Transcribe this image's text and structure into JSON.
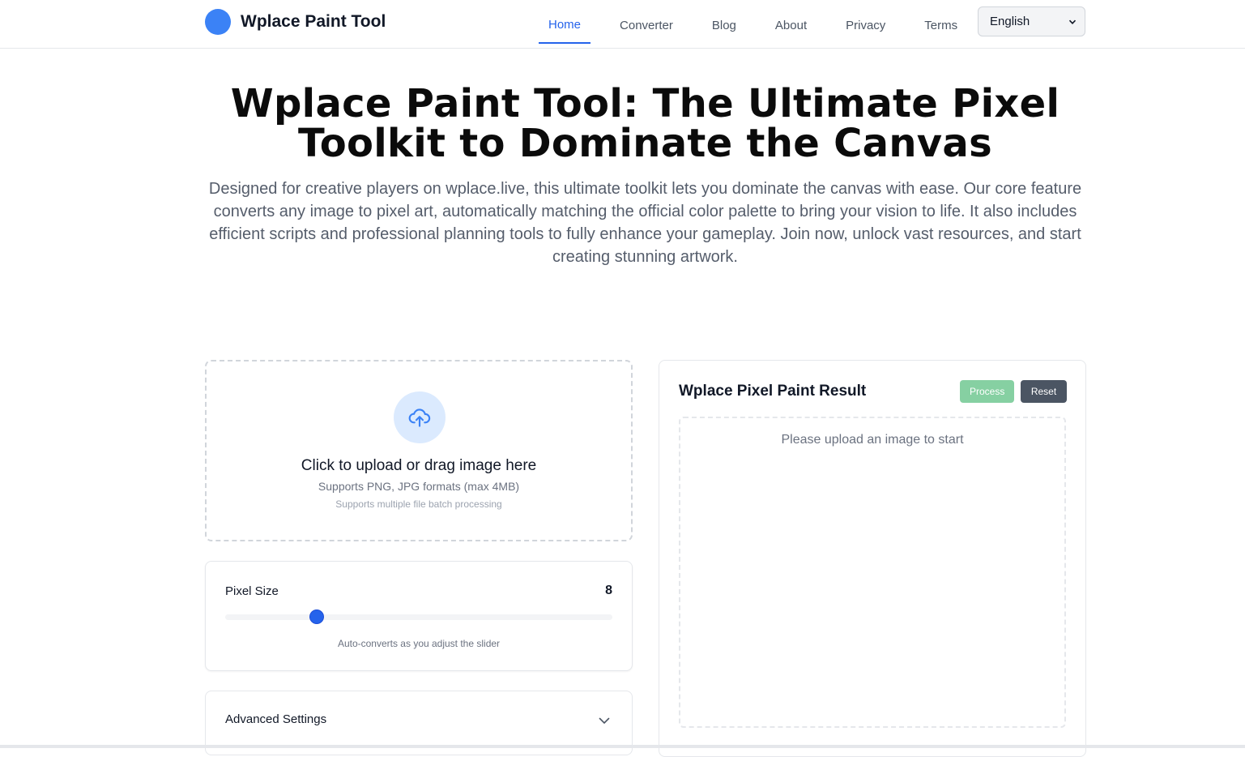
{
  "header": {
    "brand_name": "Wplace Paint Tool",
    "nav": [
      {
        "label": "Home",
        "active": true
      },
      {
        "label": "Converter"
      },
      {
        "label": "Blog"
      },
      {
        "label": "About"
      },
      {
        "label": "Privacy"
      },
      {
        "label": "Terms"
      }
    ],
    "language": {
      "selected": "English"
    }
  },
  "hero": {
    "title": "Wplace Paint Tool: The Ultimate Pixel Toolkit to Dominate the Canvas",
    "description": "Designed for creative players on wplace.live, this ultimate toolkit lets you dominate the canvas with ease. Our core feature converts any image to pixel art, automatically matching the official color palette to bring your vision to life. It also includes efficient scripts and professional planning tools to fully enhance your gameplay. Join now, unlock vast resources, and start creating stunning artwork."
  },
  "upload": {
    "title": "Click to upload or drag image here",
    "formats": "Supports PNG, JPG formats (max 4MB)",
    "batch": "Supports multiple file batch processing",
    "icon": "cloud-upload-icon"
  },
  "pixel_size": {
    "label": "Pixel Size",
    "value": "8",
    "slider_fraction": 0.237,
    "hint": "Auto-converts as you adjust the slider"
  },
  "advanced": {
    "label": "Advanced Settings",
    "icon": "chevron-down-icon"
  },
  "result": {
    "title": "Wplace Pixel Paint Result",
    "process_label": "Process",
    "reset_label": "Reset",
    "placeholder": "Please upload an image to start"
  },
  "colors": {
    "accent": "#2563eb",
    "logo": "#3b82f6",
    "process_button": "#86d0a2",
    "reset_button": "#4b5563"
  }
}
